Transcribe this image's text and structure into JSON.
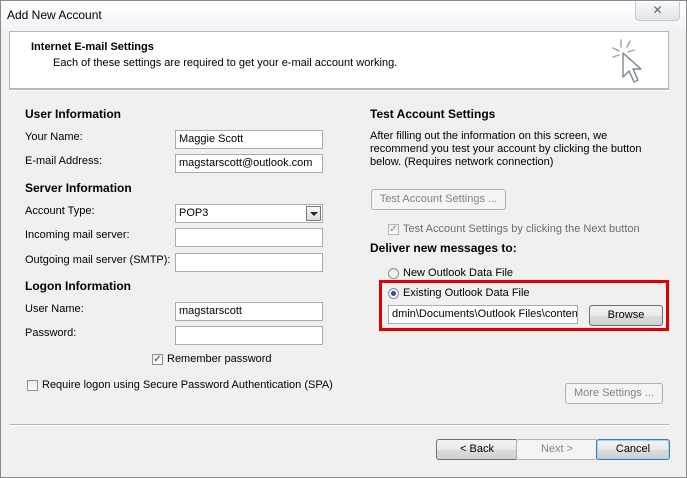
{
  "window": {
    "title": "Add New Account",
    "close_glyph": "✕"
  },
  "header": {
    "title": "Internet E-mail Settings",
    "subtitle": "Each of these settings are required to get your e-mail account working.",
    "icon": "cursor-sparkle-icon"
  },
  "user_info": {
    "heading": "User Information",
    "your_name_label": "Your Name:",
    "your_name_value": "Maggie Scott",
    "email_label": "E-mail Address:",
    "email_value": "magstarscott@outlook.com"
  },
  "server_info": {
    "heading": "Server Information",
    "account_type_label": "Account Type:",
    "account_type_value": "POP3",
    "incoming_label": "Incoming mail server:",
    "incoming_value": "",
    "outgoing_label": "Outgoing mail server (SMTP):",
    "outgoing_value": ""
  },
  "logon_info": {
    "heading": "Logon Information",
    "username_label": "User Name:",
    "username_value": "magstarscott",
    "password_label": "Password:",
    "password_value": "",
    "remember_label": "Remember password",
    "remember_checked": true,
    "spa_label": "Require logon using Secure Password Authentication (SPA)",
    "spa_checked": false
  },
  "test_settings": {
    "heading": "Test Account Settings",
    "description_line1": "After filling out the information on this screen, we",
    "description_line2": "recommend you test your account by clicking the button",
    "description_line3": "below. (Requires network connection)",
    "test_button": "Test Account Settings ...",
    "test_next_label": "Test Account Settings by clicking the Next button",
    "test_next_checked": true
  },
  "deliver": {
    "heading": "Deliver new messages to:",
    "option_new": "New Outlook Data File",
    "option_existing": "Existing Outlook Data File",
    "selected": "existing",
    "path_value": "dmin\\Documents\\Outlook Files\\content.",
    "browse_button": "Browse"
  },
  "more_settings_button": "More Settings ...",
  "footer": {
    "back_button": "< Back",
    "next_button": "Next >",
    "cancel_button": "Cancel"
  },
  "colors": {
    "highlight": "#e00000",
    "window_bg": "#f0f0f0"
  }
}
